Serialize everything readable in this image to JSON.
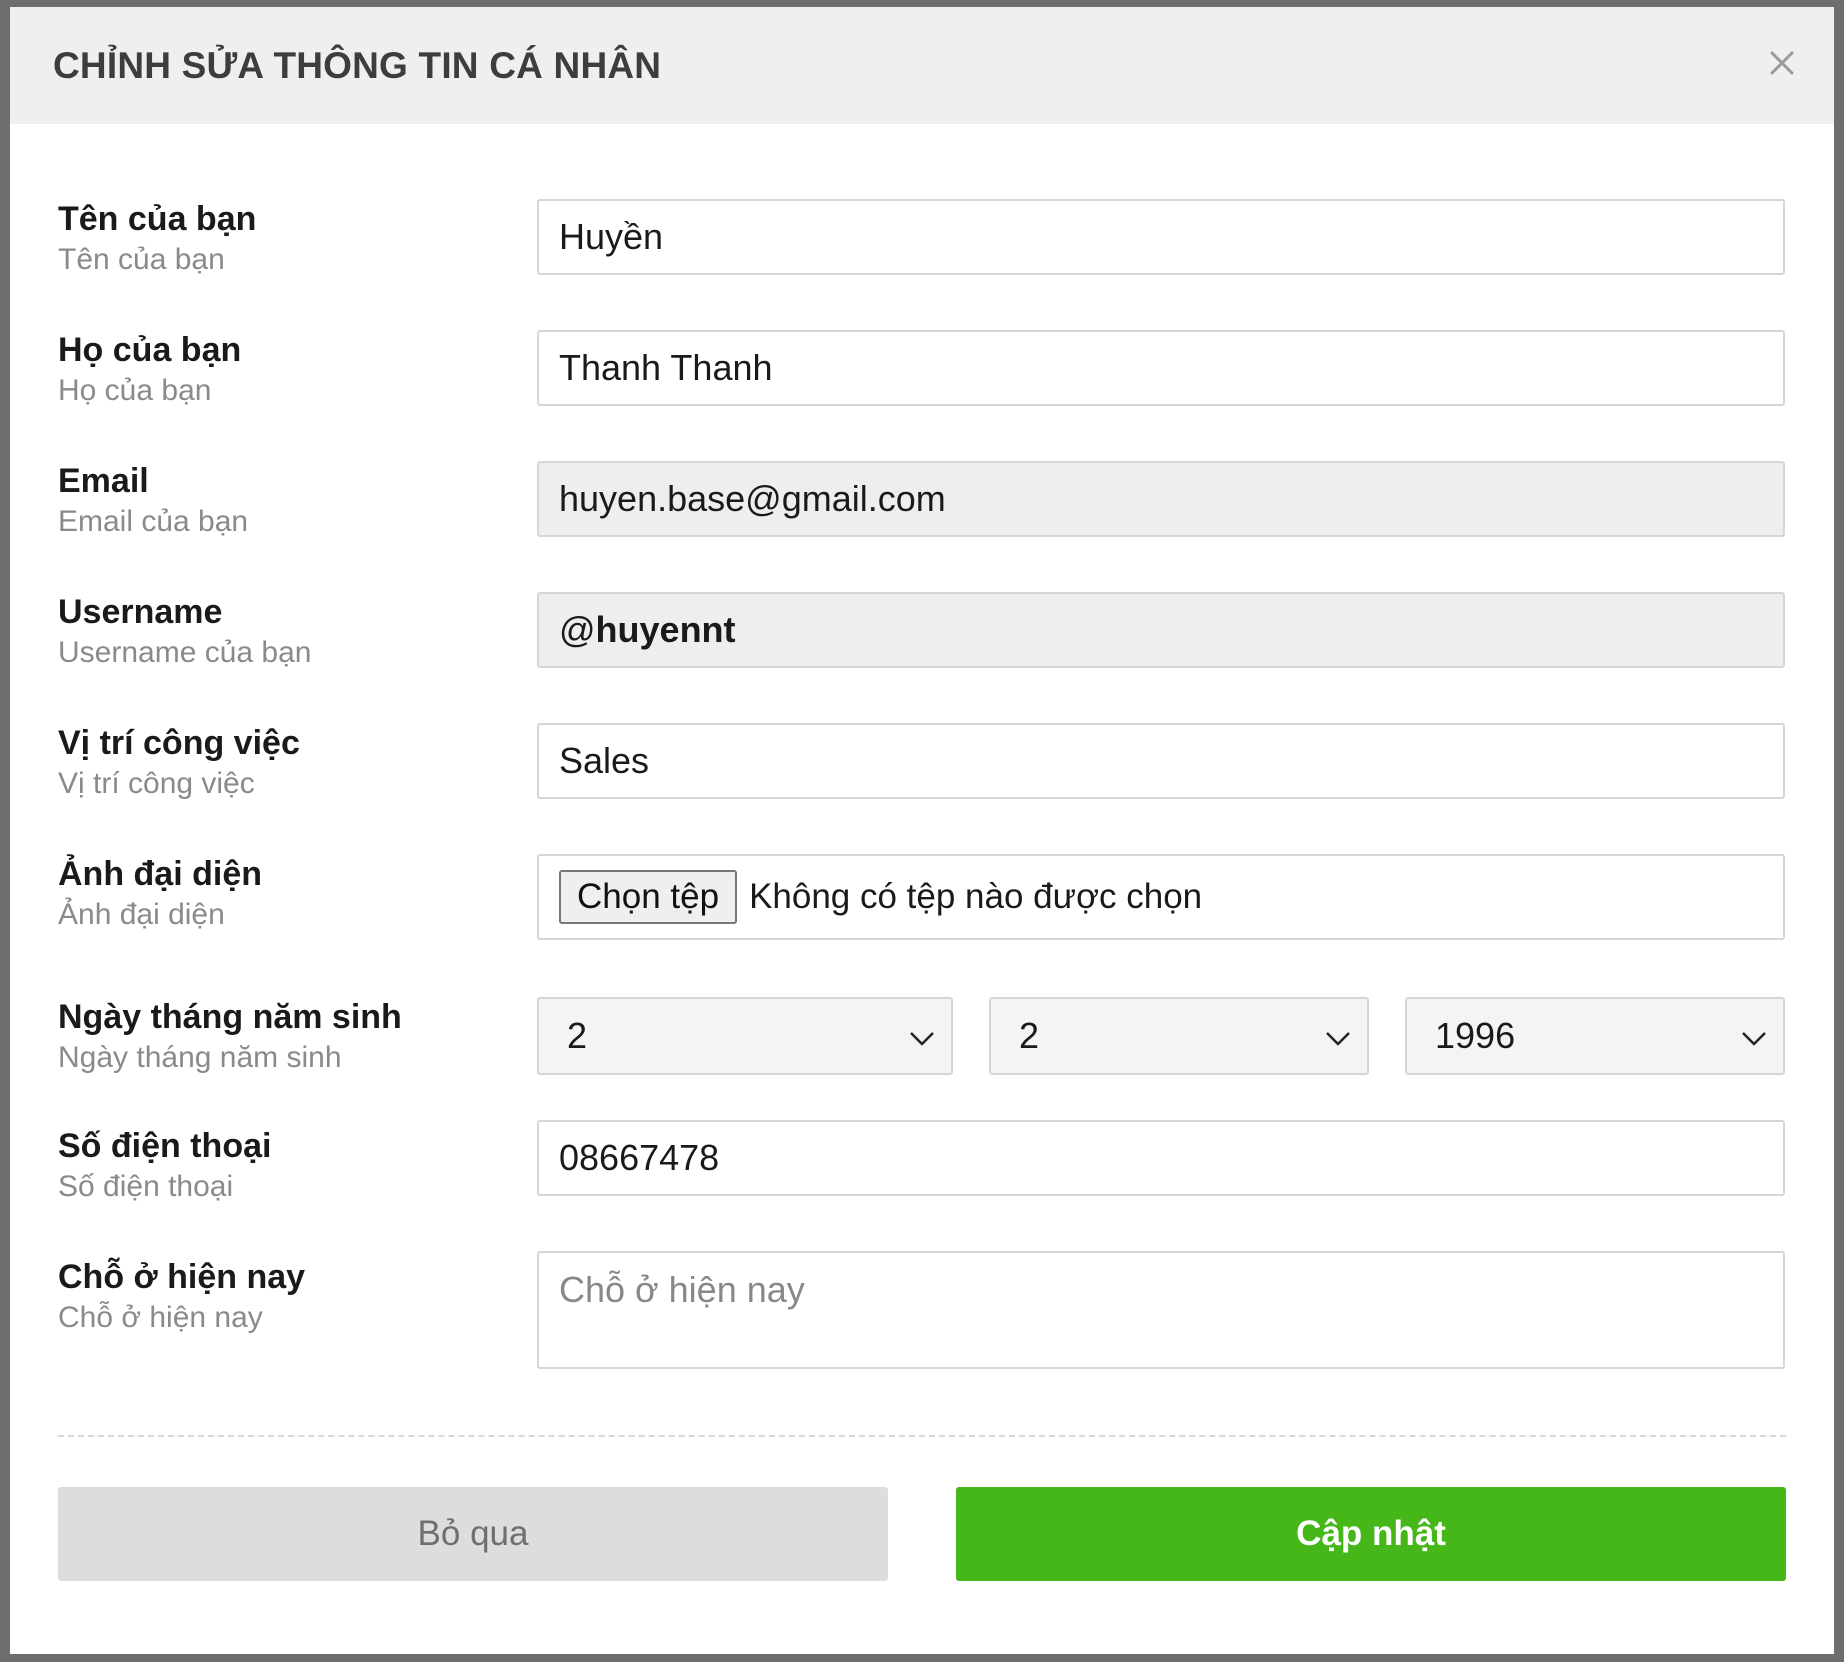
{
  "modal": {
    "title": "CHỈNH SỬA THÔNG TIN CÁ NHÂN",
    "close_icon": "close-icon"
  },
  "form": {
    "first_name": {
      "label": "Tên của bạn",
      "hint": "Tên của bạn",
      "value": "Huyền"
    },
    "last_name": {
      "label": "Họ của bạn",
      "hint": "Họ của bạn",
      "value": "Thanh Thanh"
    },
    "email": {
      "label": "Email",
      "hint": "Email của bạn",
      "value": "huyen.base@gmail.com"
    },
    "username": {
      "label": "Username",
      "hint": "Username của bạn",
      "prefix": "@",
      "value": "huyennt"
    },
    "position": {
      "label": "Vị trí công việc",
      "hint": "Vị trí công việc",
      "value": "Sales"
    },
    "avatar": {
      "label": "Ảnh đại diện",
      "hint": "Ảnh đại diện",
      "button": "Chọn tệp",
      "status": "Không có tệp nào được chọn"
    },
    "birthday": {
      "label": "Ngày tháng năm sinh",
      "hint": "Ngày tháng năm sinh",
      "day": "2",
      "month": "2",
      "year": "1996"
    },
    "phone": {
      "label": "Số điện thoại",
      "hint": "Số điện thoại",
      "value": "08667478"
    },
    "address": {
      "label": "Chỗ ở hiện nay",
      "hint": "Chỗ ở hiện nay",
      "placeholder": "Chỗ ở hiện nay"
    }
  },
  "actions": {
    "cancel": "Bỏ qua",
    "submit": "Cập nhật"
  },
  "colors": {
    "submit_bg": "#45b719",
    "cancel_bg": "#dddddd",
    "header_bg": "#efefef"
  }
}
